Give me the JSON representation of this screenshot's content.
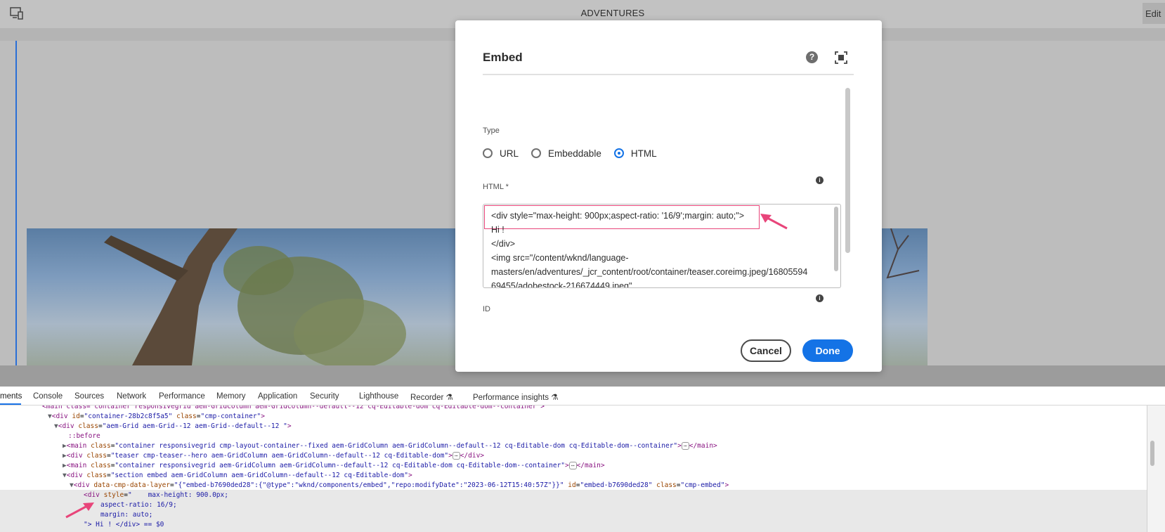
{
  "editor": {
    "page_title": "ADVENTURES",
    "edit_label": "Edit"
  },
  "dialog": {
    "title": "Embed",
    "help_glyph": "?",
    "type_label": "Type",
    "type_options": [
      "URL",
      "Embeddable",
      "HTML"
    ],
    "type_selected": "HTML",
    "html_label": "HTML *",
    "html_lines": [
      "<div style=\"max-height: 900px;aspect-ratio: '16/9';margin: auto;\">",
      "Hi !",
      "</div>",
      "<img src=\"/content/wknd/language-",
      "masters/en/adventures/_jcr_content/root/container/teaser.coreimg.jpeg/16805594",
      "69455/adobestock-216674449.jpeg\""
    ],
    "id_label": "ID",
    "cancel_label": "Cancel",
    "done_label": "Done"
  },
  "devtools": {
    "tabs": [
      "ments",
      "Console",
      "Sources",
      "Network",
      "Performance",
      "Memory",
      "Application",
      "Security",
      "Lighthouse",
      "Recorder",
      "Performance insights"
    ],
    "active_tab": "ments",
    "dom_lines": {
      "l0": "<main class=\"container responsivegrid aem-GridColumn aem-GridColumn--default--12 cq-Editable-dom cq-Editable-dom--container\">",
      "l1_tag": "<div",
      "l1_an": "id",
      "l1_av": "\"container-28b2c8f5a5\"",
      "l1_an2": "class",
      "l1_av2": "\"cmp-container\"",
      "l2_av": "\"aem-Grid aem-Grid--12 aem-Grid--default--12 \"",
      "l3": "::before",
      "l4_av": "\"container responsivegrid cmp-layout-container--fixed aem-GridColumn aem-GridColumn--default--12 cq-Editable-dom cq-Editable-dom--container\"",
      "l5_av": "\"teaser cmp-teaser--hero aem-GridColumn aem-GridColumn--default--12 cq-Editable-dom\"",
      "l6_av": "\"container responsivegrid aem-GridColumn aem-GridColumn--default--12 cq-Editable-dom cq-Editable-dom--container\"",
      "l7_av": "\"section embed aem-GridColumn aem-GridColumn--default--12 cq-Editable-dom\"",
      "l8_an": "data-cmp-data-layer",
      "l8_av": "\"{\"embed-b7690ded28\":{\"@type\":\"wknd/components/embed\",\"repo:modifyDate\":\"2023-06-12T15:40:57Z\"}}\"",
      "l8_an2": "id",
      "l8_av2": "\"embed-b7690ded28\"",
      "l8_an3": "class",
      "l8_av3": "\"cmp-embed\"",
      "l9_style": "max-height: 900.0px;",
      "l10": "aspect-ratio: 16/9;",
      "l11": "margin: auto;",
      "l12": "\"> Hi ! </div> == $0"
    }
  },
  "colors": {
    "accent": "#1473e6",
    "highlight": "#e8457a"
  }
}
